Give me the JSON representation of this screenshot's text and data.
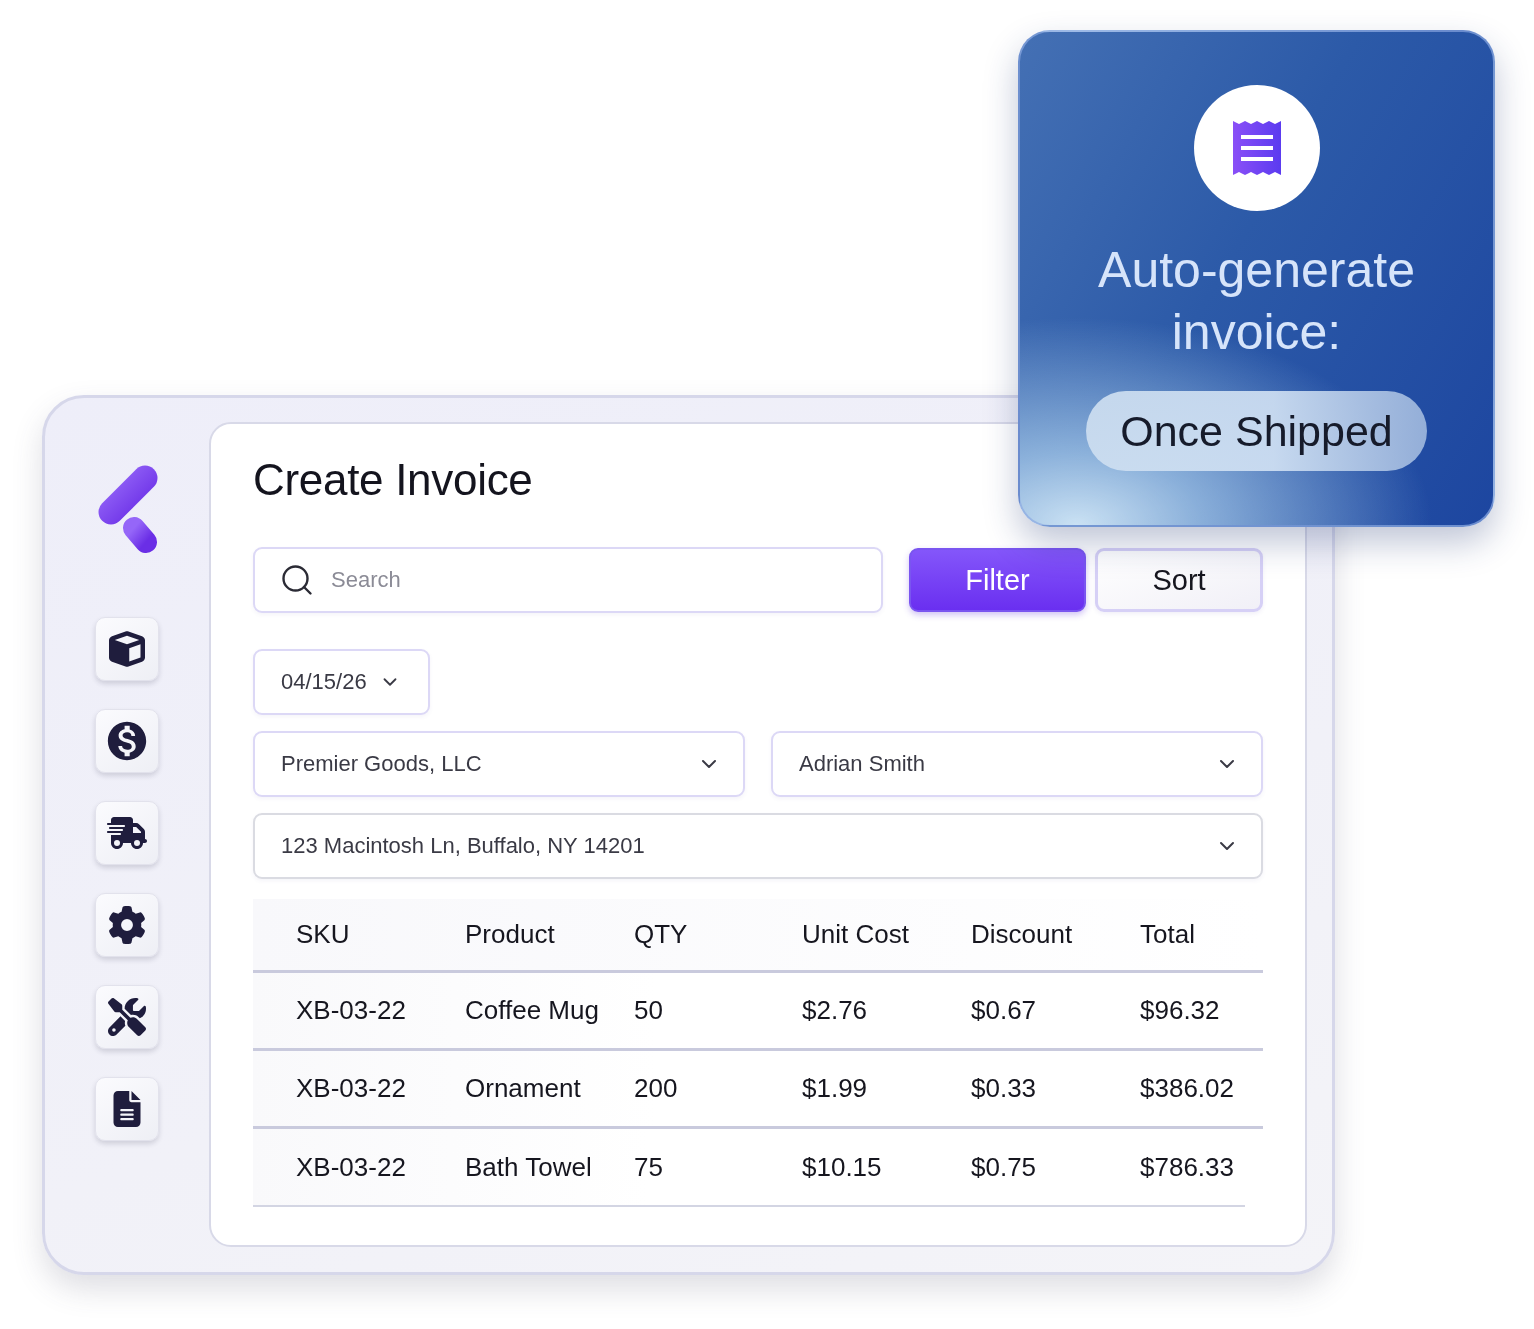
{
  "notification": {
    "title": "Auto-generate invoice:",
    "badge": "Once Shipped"
  },
  "page": {
    "title": "Create Invoice"
  },
  "search": {
    "placeholder": "Search"
  },
  "buttons": [
    {
      "label": "Filter",
      "kind": "primary"
    },
    {
      "label": "Sort",
      "kind": "secondary"
    }
  ],
  "date_select": {
    "value": "04/15/26"
  },
  "selects": [
    {
      "value": "Premier Goods, LLC"
    },
    {
      "value": "Adrian Smith"
    },
    {
      "value": "123 Macintosh Ln, Buffalo, NY 14201"
    }
  ],
  "table": {
    "columns": [
      "SKU",
      "Product",
      "QTY",
      "Unit Cost",
      "Discount",
      "Total"
    ],
    "rows": [
      [
        "XB-03-22",
        "Coffee Mug",
        "50",
        "$2.76",
        "$0.67",
        "$96.32"
      ],
      [
        "XB-03-22",
        "Ornament",
        "200",
        "$1.99",
        "$0.33",
        "$386.02"
      ],
      [
        "XB-03-22",
        "Bath Towel",
        "75",
        "$10.15",
        "$0.75",
        "$786.33"
      ]
    ]
  }
}
